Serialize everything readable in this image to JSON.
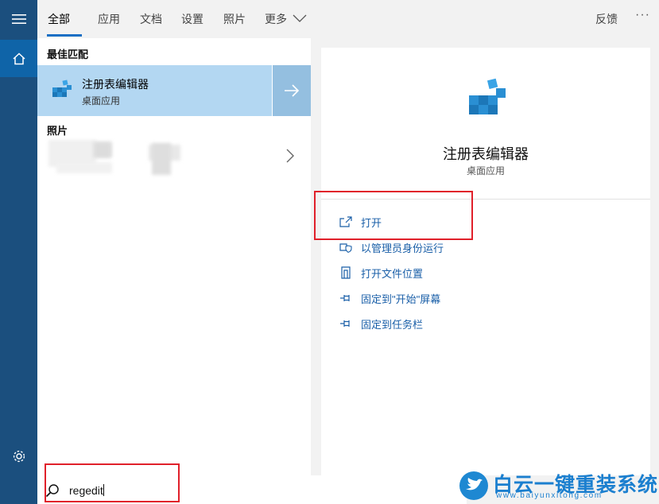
{
  "tabs": [
    {
      "label": "全部",
      "active": true
    },
    {
      "label": "应用"
    },
    {
      "label": "文档"
    },
    {
      "label": "设置"
    },
    {
      "label": "照片"
    },
    {
      "label": "更多"
    }
  ],
  "header": {
    "feedback": "反馈",
    "more_options": "···"
  },
  "results": {
    "best_match_title": "最佳匹配",
    "best_match": {
      "name": "注册表编辑器",
      "type": "桌面应用",
      "icon": "registry-editor-icon"
    },
    "photos_title": "照片"
  },
  "detail": {
    "app_name": "注册表编辑器",
    "app_type": "桌面应用",
    "actions": [
      {
        "label": "打开",
        "icon": "open-icon"
      },
      {
        "label": "以管理员身份运行",
        "icon": "shield-icon"
      },
      {
        "label": "打开文件位置",
        "icon": "file-location-icon"
      },
      {
        "label": "固定到\"开始\"屏幕",
        "icon": "pin-icon"
      },
      {
        "label": "固定到任务栏",
        "icon": "pin-icon"
      }
    ]
  },
  "search": {
    "query": "regedit"
  },
  "watermark": {
    "name": "白云一键重装系统",
    "url": "www.baiyunxitong.com"
  },
  "colors": {
    "rail": "#1b4f7e",
    "accent": "#1a6fc4",
    "selected": "#b3d7f2",
    "highlight": "#e0202a"
  }
}
